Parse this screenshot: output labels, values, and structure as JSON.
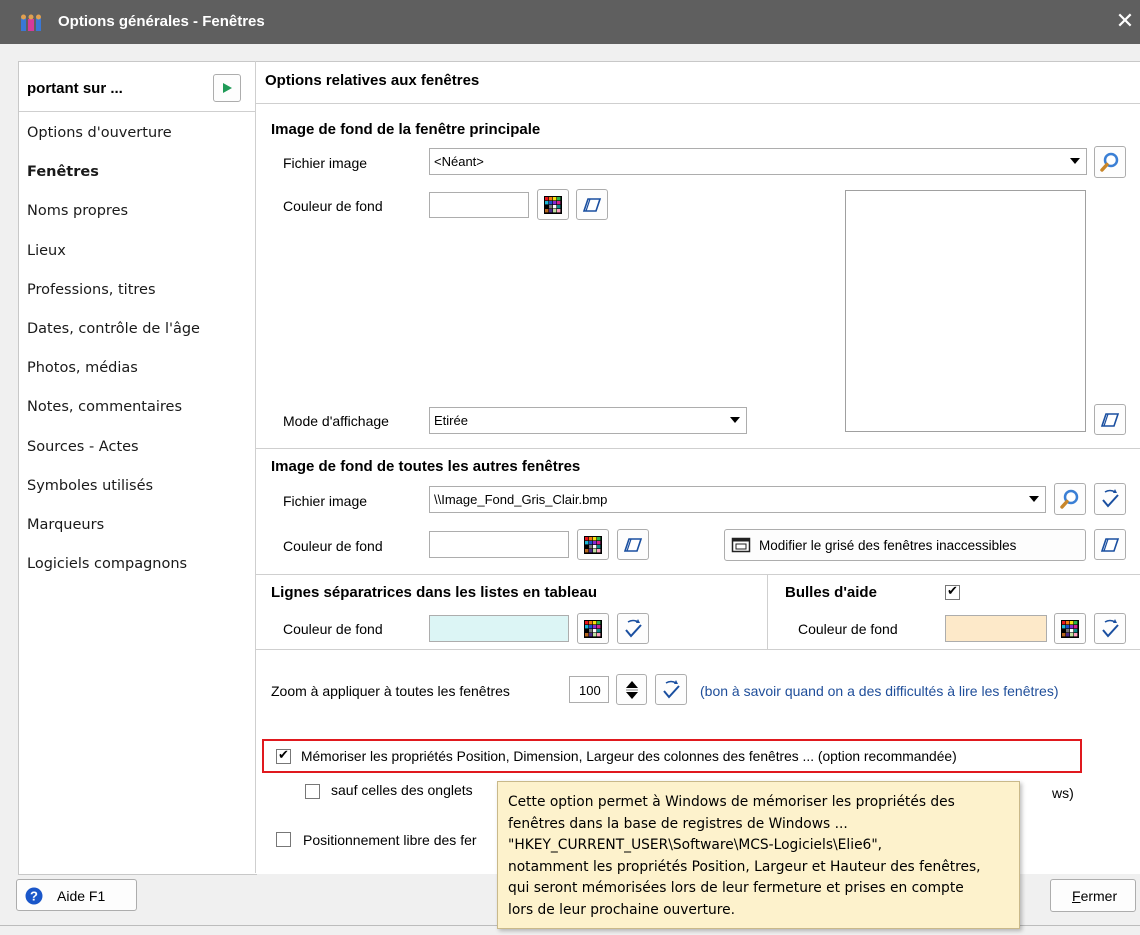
{
  "window": {
    "title": "Options générales - Fenêtres",
    "close_glyph": "✕"
  },
  "left_panel": {
    "header": "portant sur ...",
    "items": [
      {
        "label": "Options d'ouverture",
        "active": false
      },
      {
        "label": "Fenêtres",
        "active": true
      },
      {
        "label": "Noms propres",
        "active": false
      },
      {
        "label": "Lieux",
        "active": false
      },
      {
        "label": "Professions, titres",
        "active": false
      },
      {
        "label": "Dates, contrôle de l'âge",
        "active": false
      },
      {
        "label": "Photos, médias",
        "active": false
      },
      {
        "label": "Notes, commentaires",
        "active": false
      },
      {
        "label": "Sources - Actes",
        "active": false
      },
      {
        "label": "Symboles utilisés",
        "active": false
      },
      {
        "label": "Marqueurs",
        "active": false
      },
      {
        "label": "Logiciels compagnons",
        "active": false
      }
    ]
  },
  "main": {
    "header": "Options relatives aux fenêtres",
    "section1": {
      "title": "Image de fond de la fenêtre principale",
      "file_label": "Fichier image",
      "file_value": "<Néant>",
      "color_label": "Couleur de fond",
      "mode_label": "Mode d'affichage",
      "mode_value": "Etirée"
    },
    "section2": {
      "title": "Image de fond de toutes les autres fenêtres",
      "file_label": "Fichier image",
      "file_value": "\\\\Image_Fond_Gris_Clair.bmp",
      "color_label": "Couleur de fond",
      "modify_button": "Modifier le grisé des fenêtres inaccessibles"
    },
    "section3": {
      "title": "Lignes séparatrices dans les listes en tableau",
      "color_label": "Couleur de fond",
      "color_value": "#dcf5f5"
    },
    "section4": {
      "title": "Bulles d'aide",
      "checked_glyph": "✔",
      "color_label": "Couleur de fond",
      "color_value": "#fde9c9"
    },
    "zoom": {
      "label": "Zoom à appliquer à toutes les fenêtres",
      "value": "100",
      "note": "(bon à savoir quand on a des difficultés à lire les fenêtres)"
    },
    "options": {
      "memorize_label": "Mémoriser les propriétés Position, Dimension, Largeur des colonnes des fenêtres ... (option recommandée)",
      "memorize_glyph": "✔",
      "except_label": "sauf celles des onglets",
      "except_tail": "ws)",
      "free_label": "Positionnement libre des fer"
    }
  },
  "tooltip": {
    "lines": [
      "Cette option permet à Windows de mémoriser les propriétés des",
      "fenêtres dans la base de registres de Windows ...",
      "\"HKEY_CURRENT_USER\\Software\\MCS-Logiciels\\Elie6\",",
      "notamment les propriétés Position, Largeur et Hauteur des fenêtres,",
      "qui seront mémorisées lors de leur fermeture et prises en compte",
      "lors de leur prochaine ouverture."
    ]
  },
  "footer": {
    "help_label": "Aide  F1",
    "close_first": "F",
    "close_rest": "ermer"
  },
  "colors": {
    "titlebar": "#5f5f5f",
    "highlight_border": "#e0191e",
    "tooltip_bg": "#fdf2cc",
    "note_text": "#1f4e9a"
  }
}
